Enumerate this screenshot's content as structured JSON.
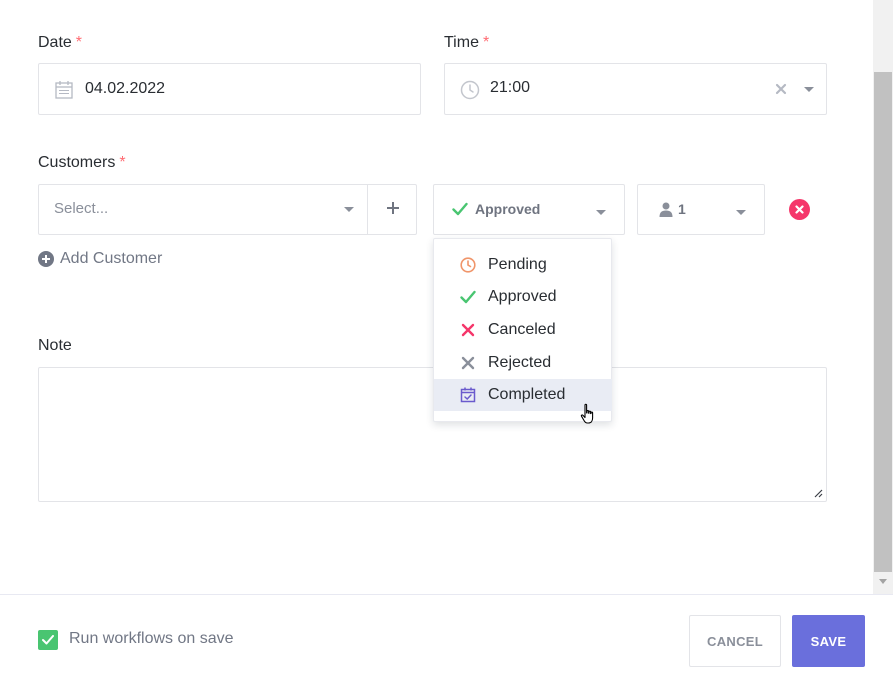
{
  "form": {
    "date": {
      "label": "Date",
      "required_mark": "*",
      "value": "04.02.2022"
    },
    "time": {
      "label": "Time",
      "required_mark": "*",
      "value": "21:00"
    },
    "customers": {
      "label": "Customers",
      "required_mark": "*",
      "select_placeholder": "Select...",
      "status_value": "Approved",
      "count_value": "1",
      "add_customer_label": "Add Customer"
    },
    "note": {
      "label": "Note",
      "value": ""
    }
  },
  "status_menu": {
    "options": [
      {
        "label": "Pending",
        "icon": "clock-icon",
        "color": "#f0956a"
      },
      {
        "label": "Approved",
        "icon": "check-icon",
        "color": "#49c571"
      },
      {
        "label": "Canceled",
        "icon": "x-icon",
        "color": "#f5366a"
      },
      {
        "label": "Rejected",
        "icon": "x-icon",
        "color": "#8a8f9a"
      },
      {
        "label": "Completed",
        "icon": "calendar-check-icon",
        "color": "#6a5acd"
      }
    ],
    "highlighted": "Completed"
  },
  "footer": {
    "run_workflows_label": "Run workflows on save",
    "run_workflows_checked": true,
    "cancel_label": "CANCEL",
    "save_label": "SAVE"
  },
  "colors": {
    "accent": "#6a6fdc",
    "success": "#49c571",
    "danger": "#f5366a",
    "required": "#ff6b72"
  }
}
